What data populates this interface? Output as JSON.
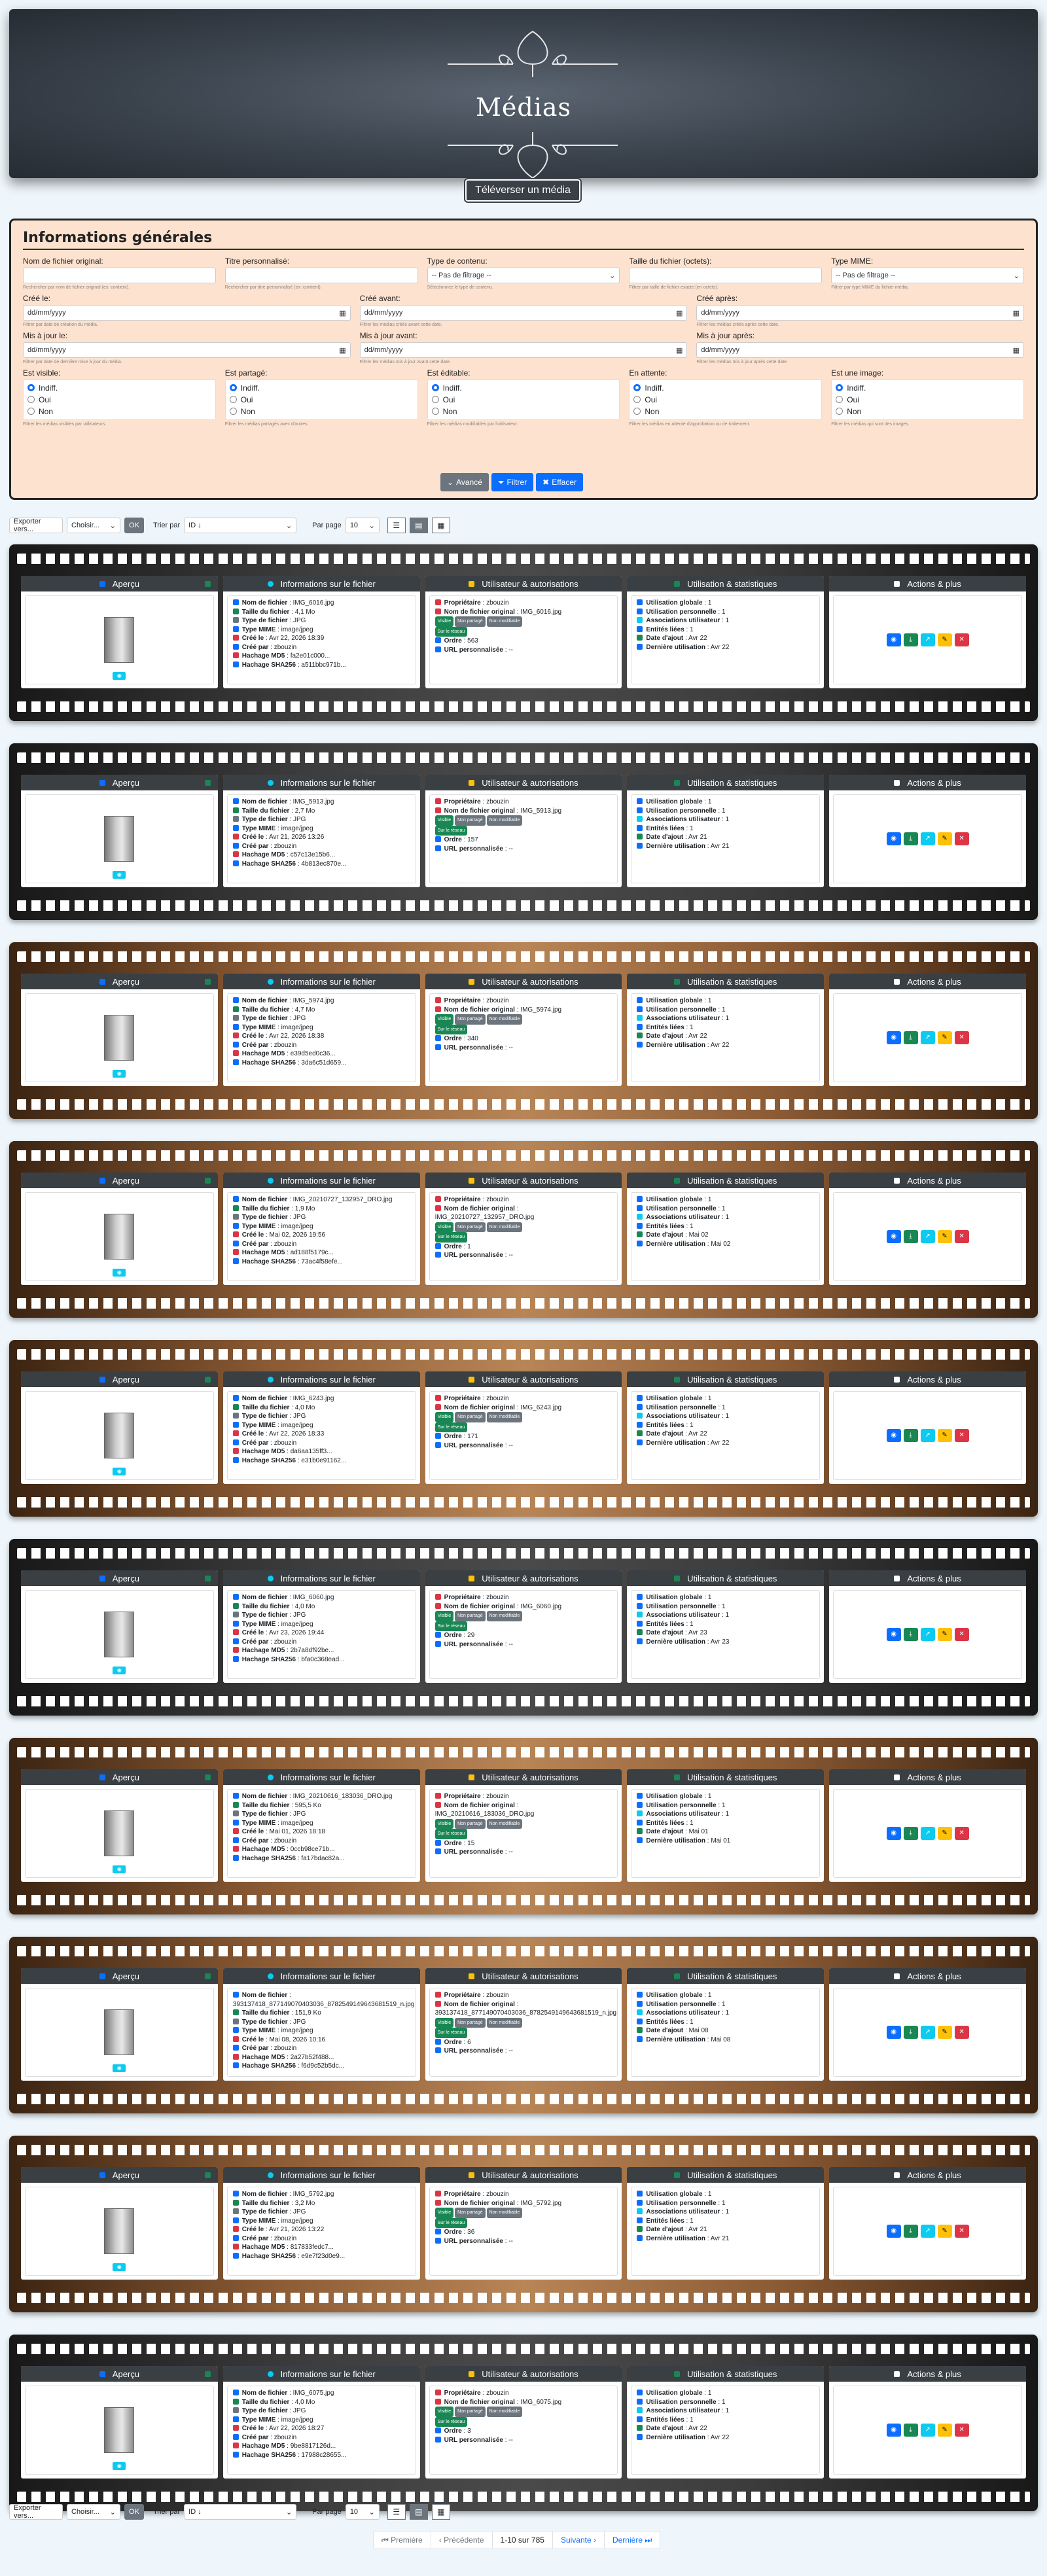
{
  "header": {
    "title": "Médias",
    "upload_label": "Téléverser un média"
  },
  "filters": {
    "title": "Informations générales",
    "fields": [
      {
        "label": "Nom de fichier original:",
        "value": "",
        "help": "Rechercher par nom de fichier original (ex: contient)."
      },
      {
        "label": "Titre personnalisé:",
        "value": "",
        "help": "Rechercher par titre personnalisé (ex: contient)."
      },
      {
        "label": "Type de contenu:",
        "value": "-- Pas de filtrage --",
        "help": "Sélectionnez le type de contenu."
      },
      {
        "label": "Taille du fichier (octets):",
        "value": "",
        "help": "Filtrer par taille de fichier exacte (en octets)."
      },
      {
        "label": "Type MIME:",
        "value": "-- Pas de filtrage --",
        "help": "Filtrer par type MIME du fichier média."
      }
    ],
    "dates": [
      {
        "label": "Créé le:",
        "value": "dd/mm/yyyy",
        "help": "Filtrer par date de création du média."
      },
      {
        "label": "Créé avant:",
        "value": "dd/mm/yyyy",
        "help": "Filtrer les médias créés avant cette date."
      },
      {
        "label": "Créé après:",
        "value": "dd/mm/yyyy",
        "help": "Filtrer les médias créés après cette date."
      },
      {
        "label": "Mis à jour le:",
        "value": "dd/mm/yyyy",
        "help": "Filtrer par date de dernière mise à jour du média."
      },
      {
        "label": "Mis à jour avant:",
        "value": "dd/mm/yyyy",
        "help": "Filtrer les médias mis à jour avant cette date."
      },
      {
        "label": "Mis à jour après:",
        "value": "dd/mm/yyyy",
        "help": "Filtrer les médias mis à jour après cette date."
      }
    ],
    "radio_groups": [
      {
        "label": "Est visible:",
        "help": "Filtrer les médias visibles par utilisateurs."
      },
      {
        "label": "Est partagé:",
        "help": "Filtrer les médias partagés avec d'autres."
      },
      {
        "label": "Est éditable:",
        "help": "Filtrer les médias modifiables par l'utilisateur."
      },
      {
        "label": "En attente:",
        "help": "Filtrer les médias en attente d'approbation ou de traitement."
      },
      {
        "label": "Est une image:",
        "help": "Filtrer les médias qui sont des images."
      }
    ],
    "radio_options": [
      "Indiff.",
      "Oui",
      "Non"
    ],
    "buttons": {
      "advanced": "Avancé",
      "filter": "Filtrer",
      "clear": "Effacer"
    }
  },
  "toolbar": {
    "export": "Exporter vers...",
    "choose": "Choisir...",
    "ok": "OK",
    "sort_label": "Trier par",
    "sort_value": "ID ↓",
    "per_page_label": "Par page",
    "per_page_value": "10"
  },
  "columns": {
    "preview": "Aperçu",
    "file_info": "Informations sur le fichier",
    "user_perm": "Utilisateur & autorisations",
    "usage": "Utilisation & statistiques",
    "actions": "Actions & plus"
  },
  "labels": {
    "file_name": "Nom de fichier",
    "file_size": "Taille du fichier",
    "file_type": "Type de fichier",
    "mime": "Type MIME",
    "created": "Créé le",
    "created_by": "Créé par",
    "md5": "Hachage MD5",
    "sha": "Hachage SHA256",
    "owner": "Propriétaire",
    "orig_name": "Nom de fichier original",
    "order": "Ordre",
    "custom_url": "URL personnalisée",
    "global_use": "Utilisation globale",
    "personal_use": "Utilisation personnelle",
    "user_assoc": "Associations utilisateur",
    "linked": "Entités liées",
    "added": "Date d'ajout",
    "last_use": "Dernière utilisation"
  },
  "badges": [
    "Visible",
    "Non partagé",
    "Non modifiable",
    "Sur le réseau"
  ],
  "colors": {
    "visible": "#198754",
    "neutral": "#6c757d",
    "network": "#198754",
    "view": "#0d6efd",
    "download": "#198754",
    "share": "#0dcaf0",
    "edit": "#ffc107",
    "delete": "#dc3545"
  },
  "media": [
    {
      "name": "IMG_6016.jpg",
      "size": "4,1 Mo",
      "type": "JPG",
      "mime": "image/jpeg",
      "created": "Avr 22, 2026 18:39",
      "by": "zbouzin",
      "md5": "fa2e01c000...",
      "sha": "a511bbc971b...",
      "owner": "zbouzin",
      "orig": "IMG_6016.jpg",
      "order": "563",
      "url": "--",
      "g": "1",
      "p": "1",
      "a": "1",
      "l": "1",
      "added": "Avr 22",
      "last": "Avr 22",
      "strip": "dark"
    },
    {
      "name": "IMG_5913.jpg",
      "size": "2,7 Mo",
      "type": "JPG",
      "mime": "image/jpeg",
      "created": "Avr 21, 2026 13:26",
      "by": "zbouzin",
      "md5": "c57c13e15b6...",
      "sha": "4b813ec870e...",
      "owner": "zbouzin",
      "orig": "IMG_5913.jpg",
      "order": "157",
      "url": "--",
      "g": "1",
      "p": "1",
      "a": "1",
      "l": "1",
      "added": "Avr 21",
      "last": "Avr 21",
      "strip": "dark"
    },
    {
      "name": "IMG_5974.jpg",
      "size": "4,7 Mo",
      "type": "JPG",
      "mime": "image/jpeg",
      "created": "Avr 22, 2026 18:38",
      "by": "zbouzin",
      "md5": "e39d5ed0c36...",
      "sha": "3da6c51d659...",
      "owner": "zbouzin",
      "orig": "IMG_5974.jpg",
      "order": "340",
      "url": "--",
      "g": "1",
      "p": "1",
      "a": "1",
      "l": "1",
      "added": "Avr 22",
      "last": "Avr 22",
      "strip": "brown"
    },
    {
      "name": "IMG_20210727_132957_DRO.jpg",
      "size": "1,9 Mo",
      "type": "JPG",
      "mime": "image/jpeg",
      "created": "Mai 02, 2026 19:56",
      "by": "zbouzin",
      "md5": "ad188f5179c...",
      "sha": "73ac4f58efe...",
      "owner": "zbouzin",
      "orig": "IMG_20210727_132957_DRO.jpg",
      "order": "1",
      "url": "--",
      "g": "1",
      "p": "1",
      "a": "1",
      "l": "1",
      "added": "Mai 02",
      "last": "Mai 02",
      "strip": "brown"
    },
    {
      "name": "IMG_6243.jpg",
      "size": "4,0 Mo",
      "type": "JPG",
      "mime": "image/jpeg",
      "created": "Avr 22, 2026 18:33",
      "by": "zbouzin",
      "md5": "da6aa135ff3...",
      "sha": "e31b0e91162...",
      "owner": "zbouzin",
      "orig": "IMG_6243.jpg",
      "order": "171",
      "url": "--",
      "g": "1",
      "p": "1",
      "a": "1",
      "l": "1",
      "added": "Avr 22",
      "last": "Avr 22",
      "strip": "brown"
    },
    {
      "name": "IMG_6060.jpg",
      "size": "4,0 Mo",
      "type": "JPG",
      "mime": "image/jpeg",
      "created": "Avr 23, 2026 19:44",
      "by": "zbouzin",
      "md5": "2b7a8df92be...",
      "sha": "bfa0c368ead...",
      "owner": "zbouzin",
      "orig": "IMG_6060.jpg",
      "order": "29",
      "url": "--",
      "g": "1",
      "p": "1",
      "a": "1",
      "l": "1",
      "added": "Avr 23",
      "last": "Avr 23",
      "strip": "dark"
    },
    {
      "name": "IMG_20210616_183036_DRO.jpg",
      "size": "595,5 Ko",
      "type": "JPG",
      "mime": "image/jpeg",
      "created": "Mai 01, 2026 18:18",
      "by": "zbouzin",
      "md5": "0ccb98ce71b...",
      "sha": "fa17bdac82a...",
      "owner": "zbouzin",
      "orig": "IMG_20210616_183036_DRO.jpg",
      "order": "15",
      "url": "--",
      "g": "1",
      "p": "1",
      "a": "1",
      "l": "1",
      "added": "Mai 01",
      "last": "Mai 01",
      "strip": "brown"
    },
    {
      "name": "393137418_877149070403036_8782549149643681519_n.jpg",
      "size": "151,9 Ko",
      "type": "JPG",
      "mime": "image/jpeg",
      "created": "Mai 08, 2026 10:16",
      "by": "zbouzin",
      "md5": "2a27b52f488...",
      "sha": "f6d9c52b5dc...",
      "owner": "zbouzin",
      "orig": "393137418_877149070403036_8782549149643681519_n.jpg",
      "order": "6",
      "url": "--",
      "g": "1",
      "p": "1",
      "a": "1",
      "l": "1",
      "added": "Mai 08",
      "last": "Mai 08",
      "strip": "brown"
    },
    {
      "name": "IMG_5792.jpg",
      "size": "3,2 Mo",
      "type": "JPG",
      "mime": "image/jpeg",
      "created": "Avr 21, 2026 13:22",
      "by": "zbouzin",
      "md5": "817833fedc7...",
      "sha": "e9e7f23d0e9...",
      "owner": "zbouzin",
      "orig": "IMG_5792.jpg",
      "order": "36",
      "url": "--",
      "g": "1",
      "p": "1",
      "a": "1",
      "l": "1",
      "added": "Avr 21",
      "last": "Avr 21",
      "strip": "brown"
    },
    {
      "name": "IMG_6075.jpg",
      "size": "4,0 Mo",
      "type": "JPG",
      "mime": "image/jpeg",
      "created": "Avr 22, 2026 18:27",
      "by": "zbouzin",
      "md5": "9be8817126d...",
      "sha": "17988c28655...",
      "owner": "zbouzin",
      "orig": "IMG_6075.jpg",
      "order": "3",
      "url": "--",
      "g": "1",
      "p": "1",
      "a": "1",
      "l": "1",
      "added": "Avr 22",
      "last": "Avr 22",
      "strip": "dark"
    }
  ],
  "pagination": {
    "first": "⏮ Première",
    "prev": "‹ Précédente",
    "range": "1-10 sur 785",
    "next": "Suivante ›",
    "last": "Dernière ⏭"
  }
}
